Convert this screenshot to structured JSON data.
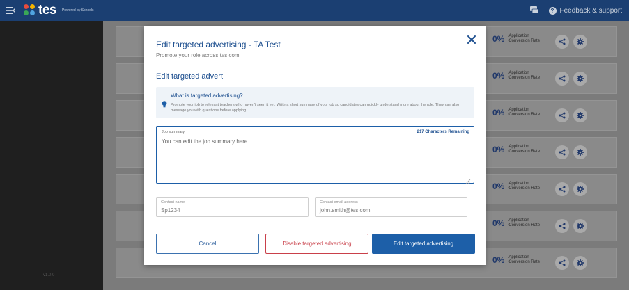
{
  "topbar": {
    "logo_text": "tes",
    "powered_by": "Powered by Schools",
    "feedback_label": "Feedback & support"
  },
  "sidebar": {
    "version": "v1.0.0"
  },
  "job_rows": [
    {
      "percent": "0%",
      "label_line1": "Application",
      "label_line2": "Conversion Rate"
    },
    {
      "percent": "0%",
      "label_line1": "Application",
      "label_line2": "Conversion Rate"
    },
    {
      "percent": "0%",
      "label_line1": "Application",
      "label_line2": "Conversion Rate"
    },
    {
      "percent": "0%",
      "label_line1": "Application",
      "label_line2": "Conversion Rate"
    },
    {
      "percent": "0%",
      "label_line1": "Application",
      "label_line2": "Conversion Rate"
    },
    {
      "percent": "0%",
      "label_line1": "Application",
      "label_line2": "Conversion Rate"
    },
    {
      "percent": "0%",
      "label_line1": "Application",
      "label_line2": "Conversion Rate"
    }
  ],
  "modal": {
    "title": "Edit targeted advertising - TA Test",
    "subtitle": "Promote your role across tes.com",
    "section_title": "Edit targeted advert",
    "info_title": "What is targeted advertising?",
    "info_text": "Promote your job to relevant teachers who haven't seen it yet. Write a short summary of your job so candidates can quickly understand more about the role. They can also message you with questions before applying.",
    "summary_label": "Job summary",
    "summary_remaining": "217 Characters Remaining",
    "summary_value": "You can edit the job summary here",
    "contact_name_label": "Contact name",
    "contact_name_value": "Sp1234",
    "contact_email_label": "Contact email address",
    "contact_email_value": "john.smith@tes.com",
    "cancel_label": "Cancel",
    "disable_label": "Disable targeted advertising",
    "edit_label": "Edit targeted advertising"
  },
  "colors": {
    "topbar": "#1b3f72",
    "primary": "#1d5fa8",
    "danger": "#c9404a"
  }
}
